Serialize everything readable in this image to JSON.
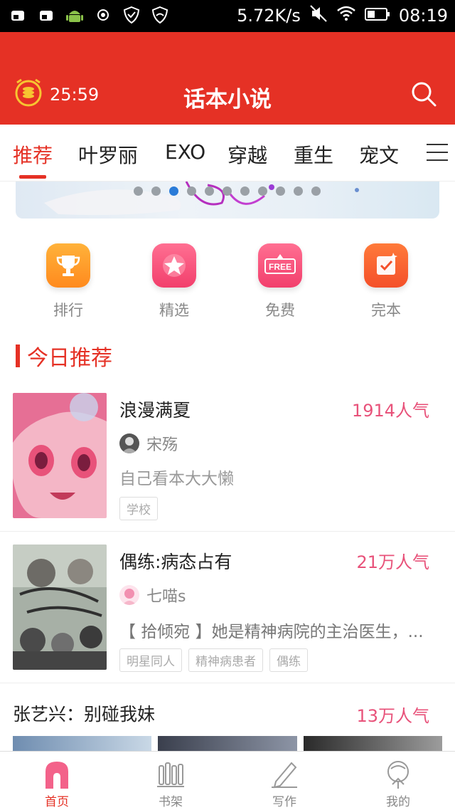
{
  "status_bar": {
    "net_speed": "5.72K/s",
    "time": "08:19"
  },
  "header": {
    "timer": "25:59",
    "title": "话本小说"
  },
  "tabs": [
    {
      "label": "推荐",
      "active": true
    },
    {
      "label": "叶罗丽"
    },
    {
      "label": "EXO"
    },
    {
      "label": "穿越"
    },
    {
      "label": "重生"
    },
    {
      "label": "宠文"
    }
  ],
  "banner": {
    "dot_count": 11,
    "active_dot": 3
  },
  "entries": [
    {
      "label": "排行",
      "icon": "trophy-icon"
    },
    {
      "label": "精选",
      "icon": "star-icon"
    },
    {
      "label": "免费",
      "icon": "free-icon",
      "icon_text": "FREE"
    },
    {
      "label": "完本",
      "icon": "check-icon"
    }
  ],
  "section": {
    "title": "今日推荐"
  },
  "books": [
    {
      "title": "浪漫满夏",
      "popularity": "1914人气",
      "author": "宋殇",
      "description": "自己看本大大懒",
      "tags": [
        "学校"
      ]
    },
    {
      "title": "偶练:病态占有",
      "popularity": "21万人气",
      "author": "七喵s",
      "description": "【 拾倾宛 】她是精神病院的主治医生，...",
      "tags": [
        "明星同人",
        "精神病患者",
        "偶练"
      ]
    },
    {
      "title": "张艺兴：别碰我妹",
      "popularity": "13万人气"
    }
  ],
  "bottom_nav": [
    {
      "label": "首页",
      "icon": "home-icon",
      "active": true
    },
    {
      "label": "书架",
      "icon": "bookshelf-icon"
    },
    {
      "label": "写作",
      "icon": "pen-icon"
    },
    {
      "label": "我的",
      "icon": "profile-icon"
    }
  ],
  "colors": {
    "brand_red": "#e53125",
    "popularity_pink": "#e8527a"
  }
}
